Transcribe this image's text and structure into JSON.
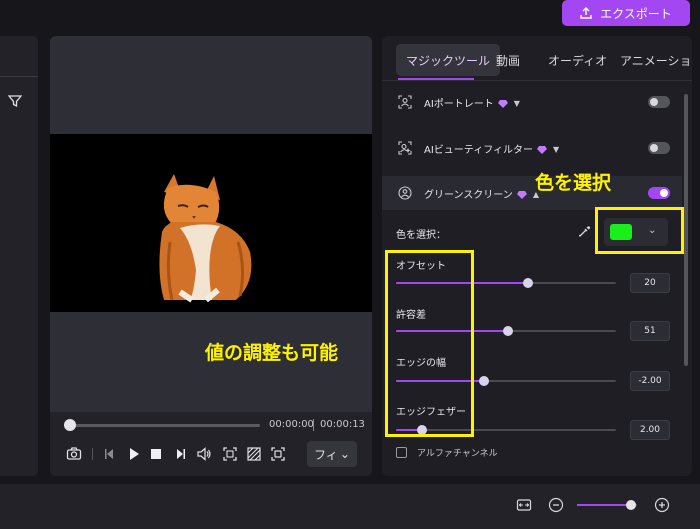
{
  "header": {
    "export_label": "エクスポート"
  },
  "player": {
    "time_current": "00:00:00",
    "time_total": "00:00:13",
    "progress": 0.0,
    "fit_label": "フィ"
  },
  "panel": {
    "tabs": [
      {
        "label": "マジックツール"
      },
      {
        "label": "動画"
      },
      {
        "label": "オーディオ"
      },
      {
        "label": "アニメーション"
      }
    ],
    "features": [
      {
        "label": "AIポートレート",
        "icon": "portrait-icon",
        "premium": true,
        "enabled": false
      },
      {
        "label": "AIビューティフィルター",
        "icon": "beauty-filter-icon",
        "premium": true,
        "enabled": false
      },
      {
        "label": "グリーンスクリーン",
        "icon": "green-screen-icon",
        "premium": true,
        "enabled": true
      }
    ],
    "color_label": "色を選択：",
    "selected_color": "#19ef19",
    "sliders": [
      {
        "label": "オフセット",
        "value": "20",
        "level": 0.6
      },
      {
        "label": "許容差",
        "value": "51",
        "level": 0.51
      },
      {
        "label": "エッジの幅",
        "value": "-2.00",
        "level": 0.4
      },
      {
        "label": "エッジフェザー",
        "value": "2.00",
        "level": 0.12
      }
    ],
    "alpha_label": "アルファチャンネル"
  },
  "annotations": {
    "color_select": "色を選択",
    "adjust": "値の調整も可能"
  },
  "timeline": {
    "zoom_level": 0.9
  },
  "colors": {
    "accent": "#a347f2",
    "annotation": "#fff200"
  }
}
